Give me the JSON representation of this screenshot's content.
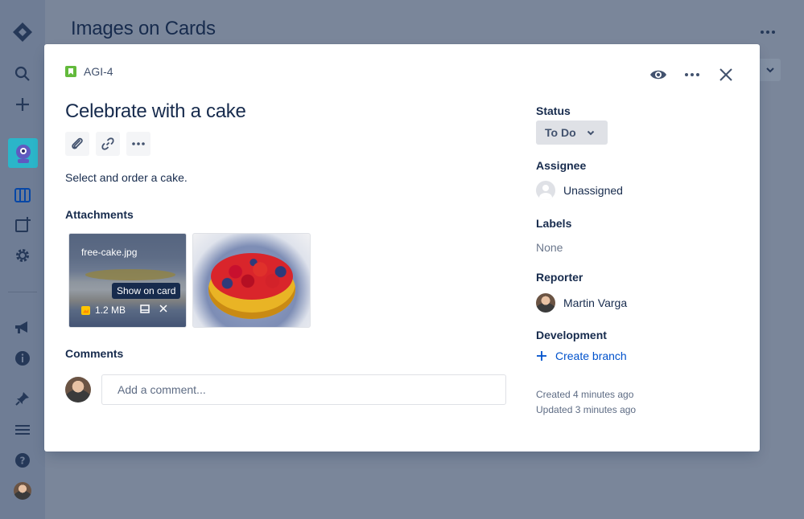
{
  "board": {
    "title": "Images on Cards"
  },
  "global_nav": {
    "items": [
      "jira-logo-icon",
      "search-icon",
      "create-icon",
      "project-avatar-icon",
      "board-icon",
      "add-item-icon",
      "settings-icon",
      "megaphone-icon",
      "info-icon",
      "pin-icon",
      "menu-icon",
      "help-icon",
      "profile-avatar-icon"
    ]
  },
  "issue": {
    "key": "AGI-4",
    "summary": "Celebrate with a cake",
    "description": "Select and order a cake.",
    "attachments_label": "Attachments",
    "attachments": [
      {
        "name": "free-cake.jpg",
        "size": "1.2 MB",
        "tooltip": "Show on card"
      },
      {
        "name": "",
        "size": "",
        "tooltip": ""
      }
    ],
    "comments_label": "Comments",
    "comment_placeholder": "Add a comment..."
  },
  "side": {
    "status_label": "Status",
    "status_value": "To Do",
    "assignee_label": "Assignee",
    "assignee_value": "Unassigned",
    "labels_label": "Labels",
    "labels_value": "None",
    "reporter_label": "Reporter",
    "reporter_value": "Martin Varga",
    "development_label": "Development",
    "create_branch": "Create branch",
    "created": "Created 4 minutes ago",
    "updated": "Updated 3 minutes ago"
  },
  "colors": {
    "accent": "#0052cc",
    "story": "#63ba3c",
    "overlay": "#7a869a"
  }
}
